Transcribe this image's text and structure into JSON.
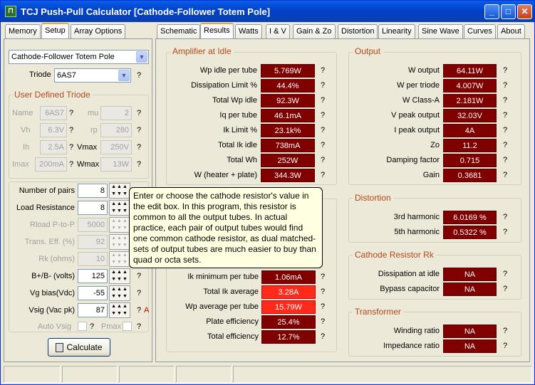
{
  "window": {
    "title": "TCJ Push-Pull Calculator [Cathode-Follower Totem Pole]",
    "app_icon": "tube-app-icon"
  },
  "left_tabs": [
    {
      "label": "Memory"
    },
    {
      "label": "Setup"
    },
    {
      "label": "Array Options"
    }
  ],
  "right_tabs": [
    {
      "label": "Schematic"
    },
    {
      "label": "Results"
    },
    {
      "label": "Watts"
    },
    {
      "label": "I & V"
    },
    {
      "label": "Gain & Zo"
    },
    {
      "label": "Distortion"
    },
    {
      "label": "Linearity"
    },
    {
      "label": "Sine Wave"
    },
    {
      "label": "Curves"
    },
    {
      "label": "About"
    }
  ],
  "setup": {
    "topology": "Cathode-Follower Totem Pole",
    "triode_label": "Triode",
    "triode_value": "6AS7",
    "help": "?",
    "user_triode": {
      "title": "User Defined Triode",
      "name_label": "Name",
      "name_value": "6AS7",
      "mu_label": "mu",
      "mu_value": "2",
      "vh_label": "Vh",
      "vh_value": "6.3V",
      "rp_label": "rp",
      "rp_value": "280",
      "ih_label": "Ih",
      "ih_value": "2.5A",
      "vmax_label": "Vmax",
      "vmax_value": "250V",
      "imax_label": "Imax",
      "imax_value": "200mA",
      "wmax_label": "Wmax",
      "wmax_value": "13W"
    },
    "params": [
      {
        "label": "Number of pairs",
        "value": "8",
        "enabled": true
      },
      {
        "label": "Load Resistance",
        "value": "8",
        "enabled": true
      },
      {
        "label": "Rload P-to-P",
        "value": "5000",
        "enabled": false
      },
      {
        "label": "Trans. Eff. (%)",
        "value": "92",
        "enabled": false
      },
      {
        "label": "Rk (ohms)",
        "value": "10",
        "enabled": false
      },
      {
        "label": "B+/B- (volts)",
        "value": "125",
        "enabled": true
      },
      {
        "label": "Vg bias(Vdc)",
        "value": "-55",
        "enabled": true
      },
      {
        "label": "Vsig (Vac pk)",
        "value": "87",
        "enabled": true
      }
    ],
    "spin_glyph": "▲▲▲\n▼▼▼",
    "a_flag": "A",
    "auto_vsig": "Auto Vsig",
    "pmax": "Pmax",
    "calculate": "Calculate"
  },
  "tooltip": "Enter or choose the cathode resistor's value in the edit box. In this program, this resistor is common to all the output tubes. In actual practice, each pair of output tubes would find one common cathode resistor, as dual matched-sets of output tubes are much easier to buy than quad or octa sets.",
  "amp_idle": {
    "title": "Amplifier at Idle",
    "rows": [
      {
        "label": "Wp idle per tube",
        "value": "5.769W"
      },
      {
        "label": "Dissipation Limit %",
        "value": "44.4%"
      },
      {
        "label": "Total Wp idle",
        "value": "92.3W"
      },
      {
        "label": "Iq per tube",
        "value": "46.1mA"
      },
      {
        "label": "Ik Limit %",
        "value": "23.1k%"
      },
      {
        "label": "Total Ik idle",
        "value": "738mA"
      },
      {
        "label": "Total Wh",
        "value": "252W"
      },
      {
        "label": "W (heater + plate)",
        "value": "344.3W"
      }
    ]
  },
  "amp_full": {
    "rows": [
      {
        "label": "Ik minimum per tube",
        "value": "1.06mA",
        "hot": false
      },
      {
        "label": "Total Ik average",
        "value": "3.28A",
        "hot": true
      },
      {
        "label": "Wp average per tube",
        "value": "15.79W",
        "hot": true
      },
      {
        "label": "Plate efficiency",
        "value": "25.4%",
        "hot": false
      },
      {
        "label": "Total efficiency",
        "value": "12.7%",
        "hot": false
      }
    ]
  },
  "output": {
    "title": "Output",
    "rows": [
      {
        "label": "W output",
        "value": "64.11W"
      },
      {
        "label": "W per triode",
        "value": "4.007W"
      },
      {
        "label": "W Class-A",
        "value": "2.181W"
      },
      {
        "label": "V peak output",
        "value": "32.03V"
      },
      {
        "label": "I peak output",
        "value": "4A"
      },
      {
        "label": "Zo",
        "value": "11.2"
      },
      {
        "label": "Damping factor",
        "value": "0.715"
      },
      {
        "label": "Gain",
        "value": "0.3681"
      }
    ]
  },
  "distortion": {
    "title": "Distortion",
    "rows": [
      {
        "label": "3rd harmonic",
        "value": "6.0169 %"
      },
      {
        "label": "5th harmonic",
        "value": "0.5322 %"
      }
    ]
  },
  "cathode_rk": {
    "title": "Cathode Resistor Rk",
    "rows": [
      {
        "label": "Dissipation at idle",
        "value": "NA"
      },
      {
        "label": "Bypass capacitor",
        "value": "NA"
      }
    ]
  },
  "transformer": {
    "title": "Transformer",
    "rows": [
      {
        "label": "Winding ratio",
        "value": "NA"
      },
      {
        "label": "Impedance ratio",
        "value": "NA"
      }
    ]
  }
}
